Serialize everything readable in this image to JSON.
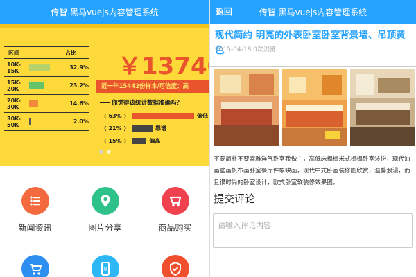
{
  "left": {
    "header_title": "传智.黑马vuejs内容管理系统",
    "banner": {
      "table_headers": [
        "区间",
        "占比"
      ],
      "rows": [
        {
          "range": "10K-15K",
          "percent": "32.9%",
          "value": 32.9,
          "color": "#b8d26a"
        },
        {
          "range": "15K-20K",
          "percent": "23.2%",
          "value": 23.2,
          "color": "#65c36b"
        },
        {
          "range": "20K-30K",
          "percent": "14.6%",
          "value": 14.6,
          "color": "#f08a3a"
        },
        {
          "range": "30K-50K",
          "percent": "2.0%",
          "value": 2.0,
          "color": "#555555"
        }
      ],
      "price": "￥13740",
      "sample_text": "近一年15442份样本/可信度：高",
      "question": "你觉得该统计数据准确吗？",
      "poll": [
        {
          "label": "( 63% )",
          "value": 63,
          "text": "偏低",
          "color": "#e9542c"
        },
        {
          "label": "( 21% )",
          "value": 21,
          "text": "靠谱",
          "color": "#444444"
        },
        {
          "label": "( 15% )",
          "value": 15,
          "text": "偏高",
          "color": "#444444"
        }
      ],
      "accent_color": "#e9542c",
      "background_color": "#fdd93a"
    },
    "grid": [
      {
        "label": "新闻资讯",
        "icon": "list-icon",
        "color": "#f26a3d"
      },
      {
        "label": "图片分享",
        "icon": "location-pin-icon",
        "color": "#2ec28a"
      },
      {
        "label": "商品购买",
        "icon": "shop-logo-icon",
        "color": "#f0414f"
      },
      {
        "label": "",
        "icon": "shopping-cart-icon",
        "color": "#2d8ff0"
      },
      {
        "label": "",
        "icon": "yen-phone-icon",
        "color": "#2db7f5"
      },
      {
        "label": "",
        "icon": "check-shield-icon",
        "color": "#f04f2d"
      }
    ]
  },
  "right": {
    "header_title": "传智.黑马vuejs内容管理系统",
    "back_label": "返回",
    "article": {
      "title": "现代简约 明亮的外表卧室卧室背景墙、吊顶黄色",
      "meta": "2015-04-18 0次浏览",
      "content": "不要简朴不要素雅洋气卧室我做主，高低床榻榻米式榻榻卧室装扮，现代油画壁画帆布画卧室餐厅件象映画，现代中式卧室装修图欣赏，温馨浪漫，而且很时尚的卧室设计，欧式卧室软装修效果图。"
    },
    "comment": {
      "title": "提交评论",
      "placeholder": "请输入评论内容"
    },
    "accent_color": "#26a2ff"
  }
}
